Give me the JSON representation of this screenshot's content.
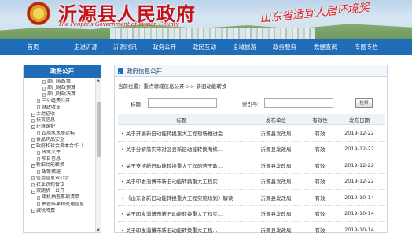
{
  "header": {
    "site_title": "沂源县人民政府",
    "site_subtitle": "The People's Government of Yiyuan County",
    "slogan": "山东省适宜人居环境奖"
  },
  "nav": [
    "首页",
    "走进沂源",
    "沂源时讯",
    "政务公开",
    "政民互动",
    "全域旅游",
    "政务服务",
    "数据查阅",
    "专题专栏"
  ],
  "sidebar": {
    "title": "政务公开",
    "tree": [
      {
        "label": "部门收政策",
        "type": "file",
        "indent": 3
      },
      {
        "label": "部门财政预算",
        "type": "file",
        "indent": 3
      },
      {
        "label": "部门财政决算",
        "type": "file",
        "indent": 3
      },
      {
        "label": "三公经费公开",
        "type": "file",
        "indent": 2
      },
      {
        "label": "财政收支",
        "type": "file",
        "indent": 2
      },
      {
        "label": "土地征收",
        "type": "expand",
        "indent": 1
      },
      {
        "label": "扶贫信息",
        "type": "file",
        "indent": 1
      },
      {
        "label": "环境保护",
        "type": "expand",
        "indent": 1
      },
      {
        "label": "饮用水水质达标",
        "type": "file",
        "indent": 2
      },
      {
        "label": "食品药品安全",
        "type": "file",
        "indent": 1
      },
      {
        "label": "政府和社会资本合作（",
        "type": "expand",
        "indent": 1
      },
      {
        "label": "政策文件",
        "type": "file",
        "indent": 2
      },
      {
        "label": "项目信息",
        "type": "file",
        "indent": 2
      },
      {
        "label": "新旧动能转换",
        "type": "expand",
        "indent": 1
      },
      {
        "label": "政策措施",
        "type": "file",
        "indent": 2
      },
      {
        "label": "信用信息双公示",
        "type": "file",
        "indent": 1
      },
      {
        "label": "农业农药餐饮",
        "type": "file",
        "indent": 1
      },
      {
        "label": "双随机一公开",
        "type": "expand",
        "indent": 1
      },
      {
        "label": "随机抽查事项清单",
        "type": "file",
        "indent": 2
      },
      {
        "label": "抽查结果和处理信息",
        "type": "file",
        "indent": 2
      },
      {
        "label": "减税降费",
        "type": "expand",
        "indent": 1
      }
    ]
  },
  "main": {
    "title": "政府信息公开",
    "breadcrumb": "当前位置：重点领域信息公开 >> 新旧动能转换",
    "search": {
      "title_label": "标题：",
      "index_label": "索引号：",
      "button_label": "检索",
      "title_value": "",
      "index_value": ""
    },
    "columns": [
      "标题",
      "发布单位",
      "有效性",
      "发布日期"
    ],
    "rows": [
      {
        "title": "关于开展新旧动能转换重大工程现场推进会...",
        "unit": "沂源县发改局",
        "validity": "有效",
        "date": "2019-12-22"
      },
      {
        "title": "关于分解落实市对区县新旧动能转换考核...",
        "unit": "沂源县发改局",
        "validity": "有效",
        "date": "2019-12-22"
      },
      {
        "title": "关于支持新旧动能转换重大工程的若干政...",
        "unit": "沂源县发改局",
        "validity": "有效",
        "date": "2019-12-22"
      },
      {
        "title": "关于印发淄博市新旧动能转换重大工程实...",
        "unit": "沂源县发改局",
        "validity": "有效",
        "date": "2019-12-22"
      },
      {
        "title": "《山东省新旧动能转换重大工程实施规划》解读",
        "unit": "沂源县发改局",
        "validity": "有效",
        "date": "2019-10-14"
      },
      {
        "title": "关于印发淄博市新旧动能转换重大工程实...",
        "unit": "沂源县发改局",
        "validity": "有效",
        "date": "2019-10-14"
      },
      {
        "title": "关于印发淄博市新旧动能转换重大工程...",
        "unit": "沂源县发改局",
        "validity": "有效",
        "date": "2019-10-14"
      }
    ]
  },
  "colors": {
    "nav_bg": "#1f6cb8",
    "title_red": "#c4141b"
  }
}
